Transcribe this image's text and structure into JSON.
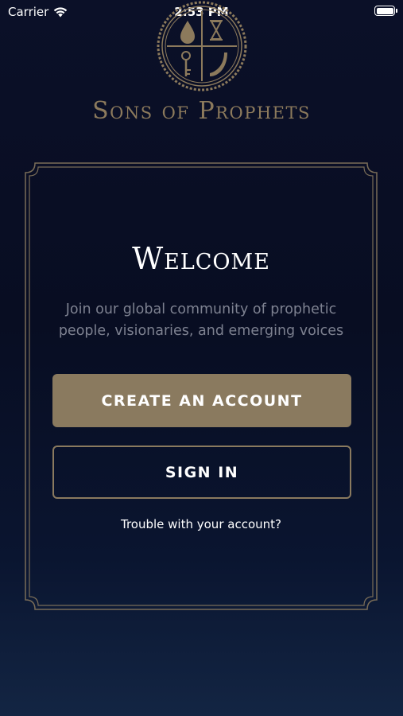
{
  "status_bar": {
    "carrier": "Carrier",
    "time": "2:53 PM",
    "battery_level": 1.0
  },
  "brand": {
    "name": "Sons of Prophets",
    "emblem_icon": "sons-of-prophets-emblem"
  },
  "welcome": {
    "title": "Welcome",
    "subtitle_line1": "Join our global community of prophetic",
    "subtitle_line2": "people, visionaries, and emerging voices"
  },
  "actions": {
    "create_account_label": "CREATE AN ACCOUNT",
    "sign_in_label": "SIGN IN",
    "trouble_label": "Trouble with your account?"
  },
  "colors": {
    "background_top": "#0b1028",
    "background_bottom": "#132543",
    "accent_gold": "#8a7a5f",
    "text_muted": "#7d8190"
  }
}
